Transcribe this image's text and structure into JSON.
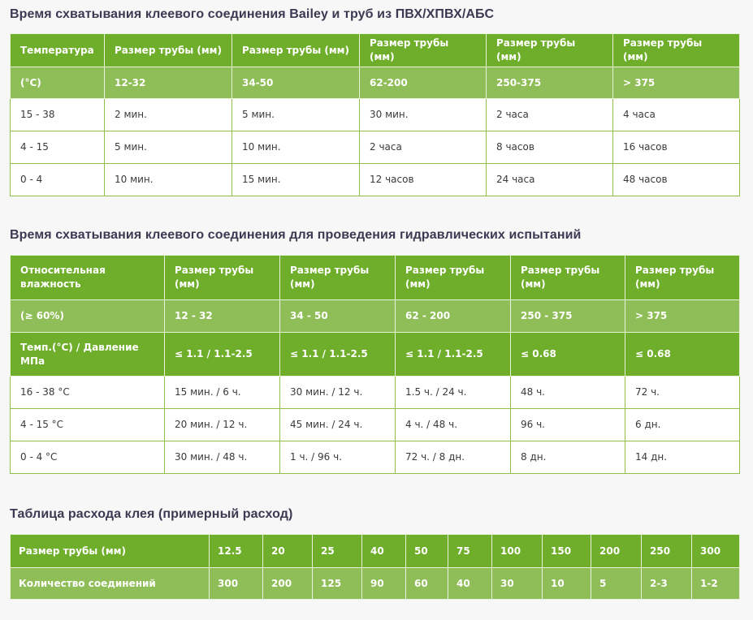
{
  "section1": {
    "title": "Время схватывания клеевого соединения Bailey и труб из ПВХ/ХПВХ/АБС",
    "header": [
      "Температура",
      "Размер трубы (мм)",
      "Размер трубы (мм)",
      "Размер трубы (мм)",
      "Размер трубы (мм)",
      "Размер трубы (мм)"
    ],
    "subheader": [
      "(°C)",
      "12-32",
      "34-50",
      "62-200",
      "250-375",
      "> 375"
    ],
    "rows": [
      [
        "15 - 38",
        "2 мин.",
        "5 мин.",
        "30 мин.",
        "2 часа",
        "4 часа"
      ],
      [
        "4 - 15",
        "5 мин.",
        "10 мин.",
        "2 часа",
        "8 часов",
        "16 часов"
      ],
      [
        "0 - 4",
        "10 мин.",
        "15 мин.",
        "12 часов",
        "24 часа",
        "48 часов"
      ]
    ]
  },
  "section2": {
    "title": "Время схватывания клеевого соединения для проведения гидравлических испытаний",
    "header": [
      "Относительная влажность",
      "Размер трубы (мм)",
      "Размер трубы (мм)",
      "Размер трубы (мм)",
      "Размер трубы (мм)",
      "Размер трубы (мм)"
    ],
    "subheader": [
      "(≥ 60%)",
      "12 - 32",
      "34 - 50",
      "62 - 200",
      "250 - 375",
      "> 375"
    ],
    "pressure": [
      "Темп.(°C) / Давление МПа",
      "≤ 1.1 / 1.1-2.5",
      "≤ 1.1 / 1.1-2.5",
      "≤ 1.1 / 1.1-2.5",
      "≤ 0.68",
      "≤ 0.68"
    ],
    "rows": [
      [
        "16 - 38 °C",
        "15 мин. / 6 ч.",
        "30 мин. / 12 ч.",
        "1.5 ч. / 24 ч.",
        "48 ч.",
        "72 ч."
      ],
      [
        "4 - 15 °C",
        "20 мин. / 12 ч.",
        "45 мин. / 24 ч.",
        "4 ч. / 48 ч.",
        "96 ч.",
        "6 дн."
      ],
      [
        "0 - 4 °C",
        "30 мин. / 48 ч.",
        "1 ч. / 96 ч.",
        "72 ч. / 8 дн.",
        "8 дн.",
        "14 дн."
      ]
    ]
  },
  "section3": {
    "title": "Таблица расхода клея (примерный расход)",
    "size_label": "Размер трубы (мм)",
    "sizes": [
      "12.5",
      "20",
      "25",
      "40",
      "50",
      "75",
      "100",
      "150",
      "200",
      "250",
      "300"
    ],
    "count_label": "Количество соединений",
    "counts": [
      "300",
      "200",
      "125",
      "90",
      "60",
      "40",
      "30",
      "10",
      "5",
      "2-3",
      "1-2"
    ]
  }
}
